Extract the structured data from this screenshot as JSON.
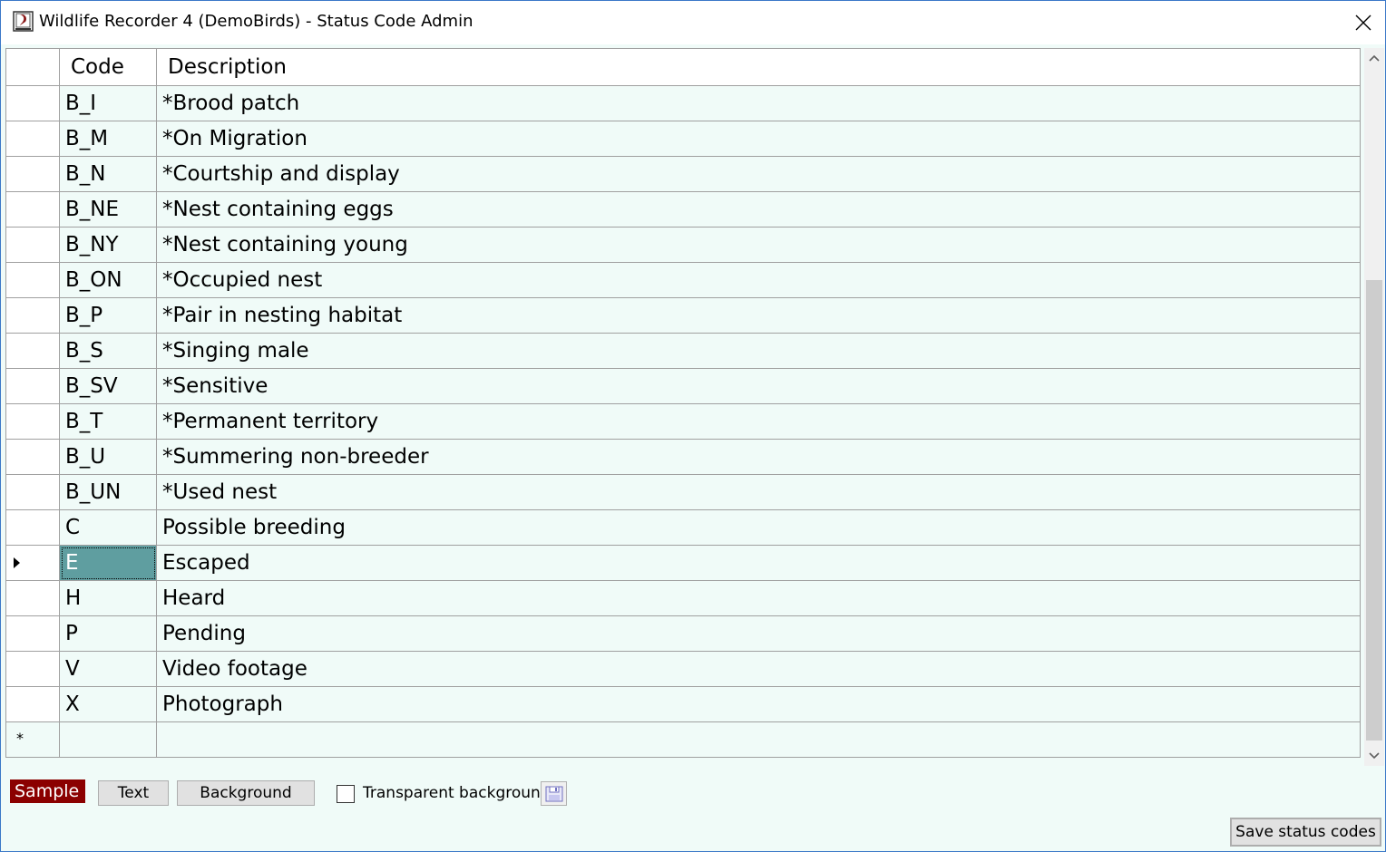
{
  "window": {
    "title": "Wildlife Recorder 4 (DemoBirds) - Status Code Admin"
  },
  "grid": {
    "columns": [
      "Code",
      "Description"
    ],
    "rows": [
      {
        "code": "B_I",
        "description": "*Brood patch"
      },
      {
        "code": "B_M",
        "description": "*On Migration"
      },
      {
        "code": "B_N",
        "description": "*Courtship and display"
      },
      {
        "code": "B_NE",
        "description": "*Nest containing eggs"
      },
      {
        "code": "B_NY",
        "description": "*Nest containing young"
      },
      {
        "code": "B_ON",
        "description": "*Occupied nest"
      },
      {
        "code": "B_P",
        "description": "*Pair in nesting habitat"
      },
      {
        "code": "B_S",
        "description": "*Singing male"
      },
      {
        "code": "B_SV",
        "description": "*Sensitive"
      },
      {
        "code": "B_T",
        "description": "*Permanent territory"
      },
      {
        "code": "B_U",
        "description": "*Summering non-breeder"
      },
      {
        "code": "B_UN",
        "description": "*Used nest"
      },
      {
        "code": "C",
        "description": "Possible breeding"
      },
      {
        "code": "E",
        "description": "Escaped"
      },
      {
        "code": "H",
        "description": "Heard"
      },
      {
        "code": "P",
        "description": "Pending"
      },
      {
        "code": "V",
        "description": "Video footage"
      },
      {
        "code": "X",
        "description": "Photograph"
      }
    ],
    "current_row_index": 13,
    "new_row_marker": "*"
  },
  "toolbar": {
    "sample_label": "Sample",
    "text_button": "Text",
    "background_button": "Background",
    "transparent_label": "Transparent background",
    "transparent_checked": false,
    "save_icon": "floppy-disk-icon",
    "save_button": "Save status codes"
  },
  "colors": {
    "grid_background": "#f0fbf8",
    "selected_cell": "#5f9ea0",
    "sample_background": "#8b0000",
    "sample_text": "#ffffff"
  }
}
